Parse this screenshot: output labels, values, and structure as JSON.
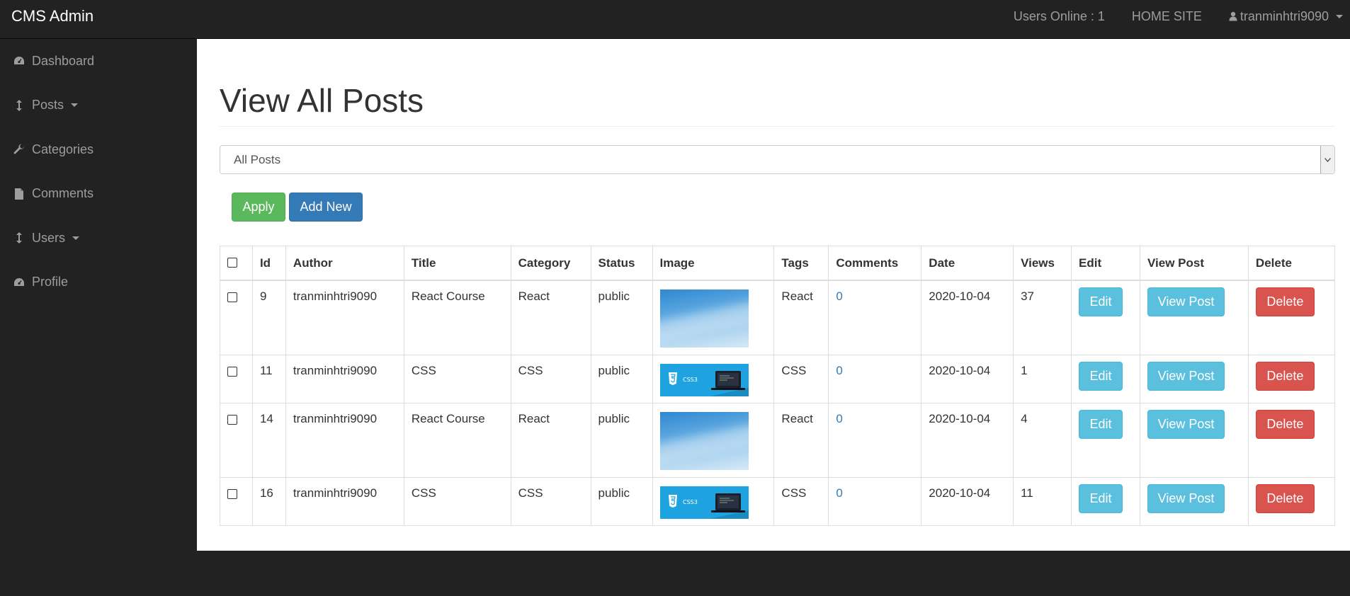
{
  "navbar": {
    "brand": "CMS Admin",
    "users_online": "Users Online : 1",
    "home_site": "HOME SITE",
    "username": "tranminhtri9090"
  },
  "sidebar": {
    "items": [
      {
        "label": "Dashboard",
        "icon": "dashboard-icon"
      },
      {
        "label": "Posts",
        "icon": "arrows-v-icon",
        "has_caret": true
      },
      {
        "label": "Categories",
        "icon": "wrench-icon"
      },
      {
        "label": "Comments",
        "icon": "file-icon"
      },
      {
        "label": "Users",
        "icon": "arrows-v-icon",
        "has_caret": true
      },
      {
        "label": "Profile",
        "icon": "dashboard-icon"
      }
    ]
  },
  "main": {
    "title": "View All Posts",
    "bulk_select": {
      "selected": "All Posts"
    },
    "apply_label": "Apply",
    "add_new_label": "Add New",
    "table": {
      "headers": [
        "Id",
        "Author",
        "Title",
        "Category",
        "Status",
        "Image",
        "Tags",
        "Comments",
        "Date",
        "Views",
        "Edit",
        "View Post",
        "Delete"
      ],
      "rows": [
        {
          "id": "9",
          "author": "tranminhtri9090",
          "title": "React Course",
          "category": "React",
          "status": "public",
          "image": "sky",
          "tags": "React",
          "comments": "0",
          "date": "2020-10-04",
          "views": "37",
          "edit": "Edit",
          "view_post": "View Post",
          "delete": "Delete"
        },
        {
          "id": "11",
          "author": "tranminhtri9090",
          "title": "CSS",
          "category": "CSS",
          "status": "public",
          "image": "css",
          "tags": "CSS",
          "comments": "0",
          "date": "2020-10-04",
          "views": "1",
          "edit": "Edit",
          "view_post": "View Post",
          "delete": "Delete"
        },
        {
          "id": "14",
          "author": "tranminhtri9090",
          "title": "React Course",
          "category": "React",
          "status": "public",
          "image": "sky",
          "tags": "React",
          "comments": "0",
          "date": "2020-10-04",
          "views": "4",
          "edit": "Edit",
          "view_post": "View Post",
          "delete": "Delete"
        },
        {
          "id": "16",
          "author": "tranminhtri9090",
          "title": "CSS",
          "category": "CSS",
          "status": "public",
          "image": "css",
          "tags": "CSS",
          "comments": "0",
          "date": "2020-10-04",
          "views": "11",
          "edit": "Edit",
          "view_post": "View Post",
          "delete": "Delete"
        }
      ]
    },
    "thumbnail_text": {
      "css": "CSS3"
    }
  },
  "colors": {
    "navbar_bg": "#222222",
    "link": "#337ab7",
    "success": "#5cb85c",
    "primary": "#337ab7",
    "info": "#5bc0de",
    "danger": "#d9534f"
  }
}
